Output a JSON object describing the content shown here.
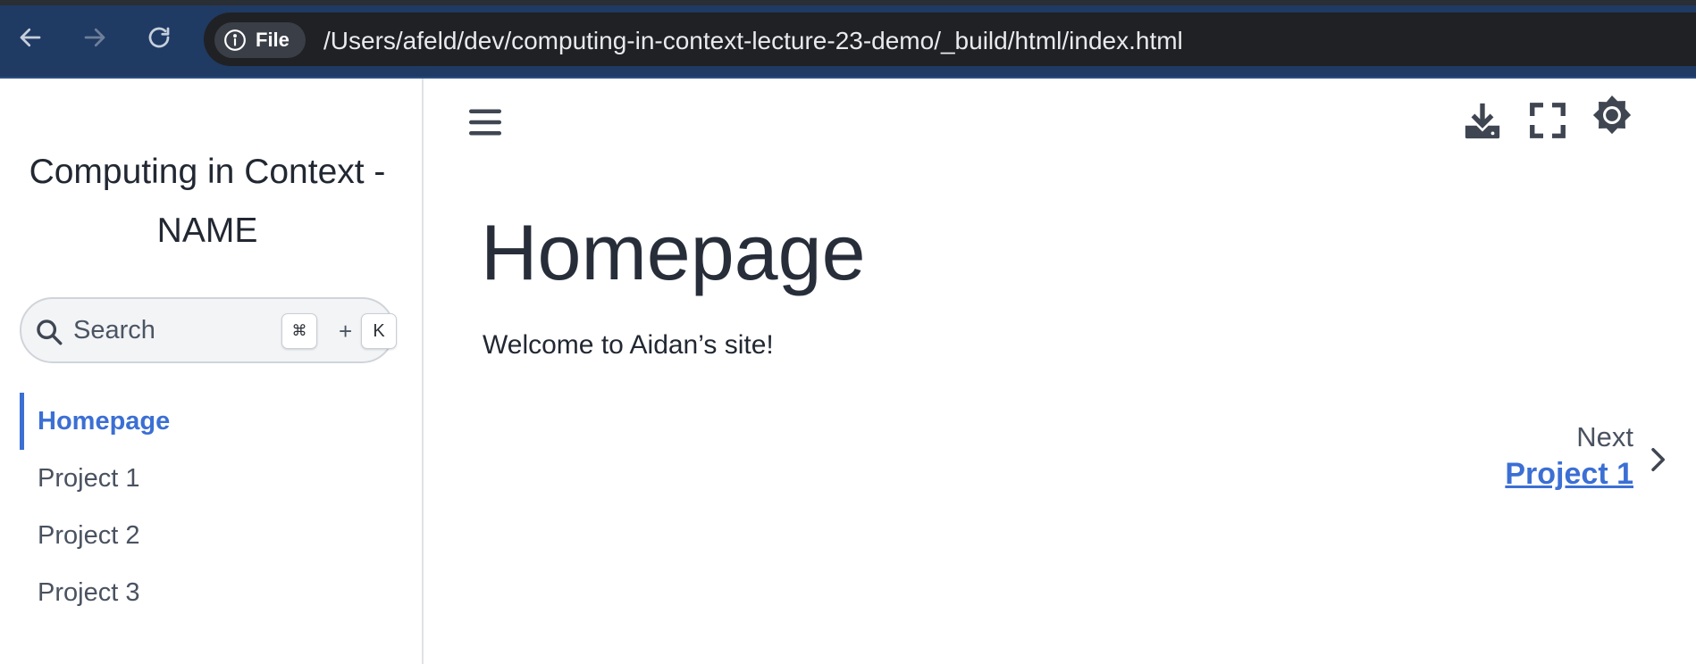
{
  "browser": {
    "file_chip_label": "File",
    "url": "/Users/afeld/dev/computing-in-context-lecture-23-demo/_build/html/index.html"
  },
  "sidebar": {
    "site_title": "Computing in Context - NAME",
    "search": {
      "label": "Search",
      "shortcut_modifier": "⌘",
      "shortcut_plus": "+",
      "shortcut_key": "K"
    },
    "items": [
      {
        "label": "Homepage",
        "active": true
      },
      {
        "label": "Project 1",
        "active": false
      },
      {
        "label": "Project 2",
        "active": false
      },
      {
        "label": "Project 3",
        "active": false
      }
    ]
  },
  "main": {
    "title": "Homepage",
    "body_text": "Welcome to Aidan’s site!",
    "next": {
      "label": "Next",
      "link": "Project 1"
    }
  },
  "colors": {
    "accent": "#3b6fd4",
    "chrome_bg": "#1f3a63",
    "omnibox_bg": "#202124",
    "text_dark": "#222832"
  },
  "icons": {
    "back": "arrow-left-icon",
    "forward": "arrow-right-icon",
    "reload": "reload-icon",
    "info": "info-icon",
    "menu": "hamburger-icon",
    "download": "download-icon",
    "fullscreen": "fullscreen-icon",
    "theme": "theme-toggle-icon",
    "search": "search-icon",
    "next": "chevron-right-icon"
  }
}
